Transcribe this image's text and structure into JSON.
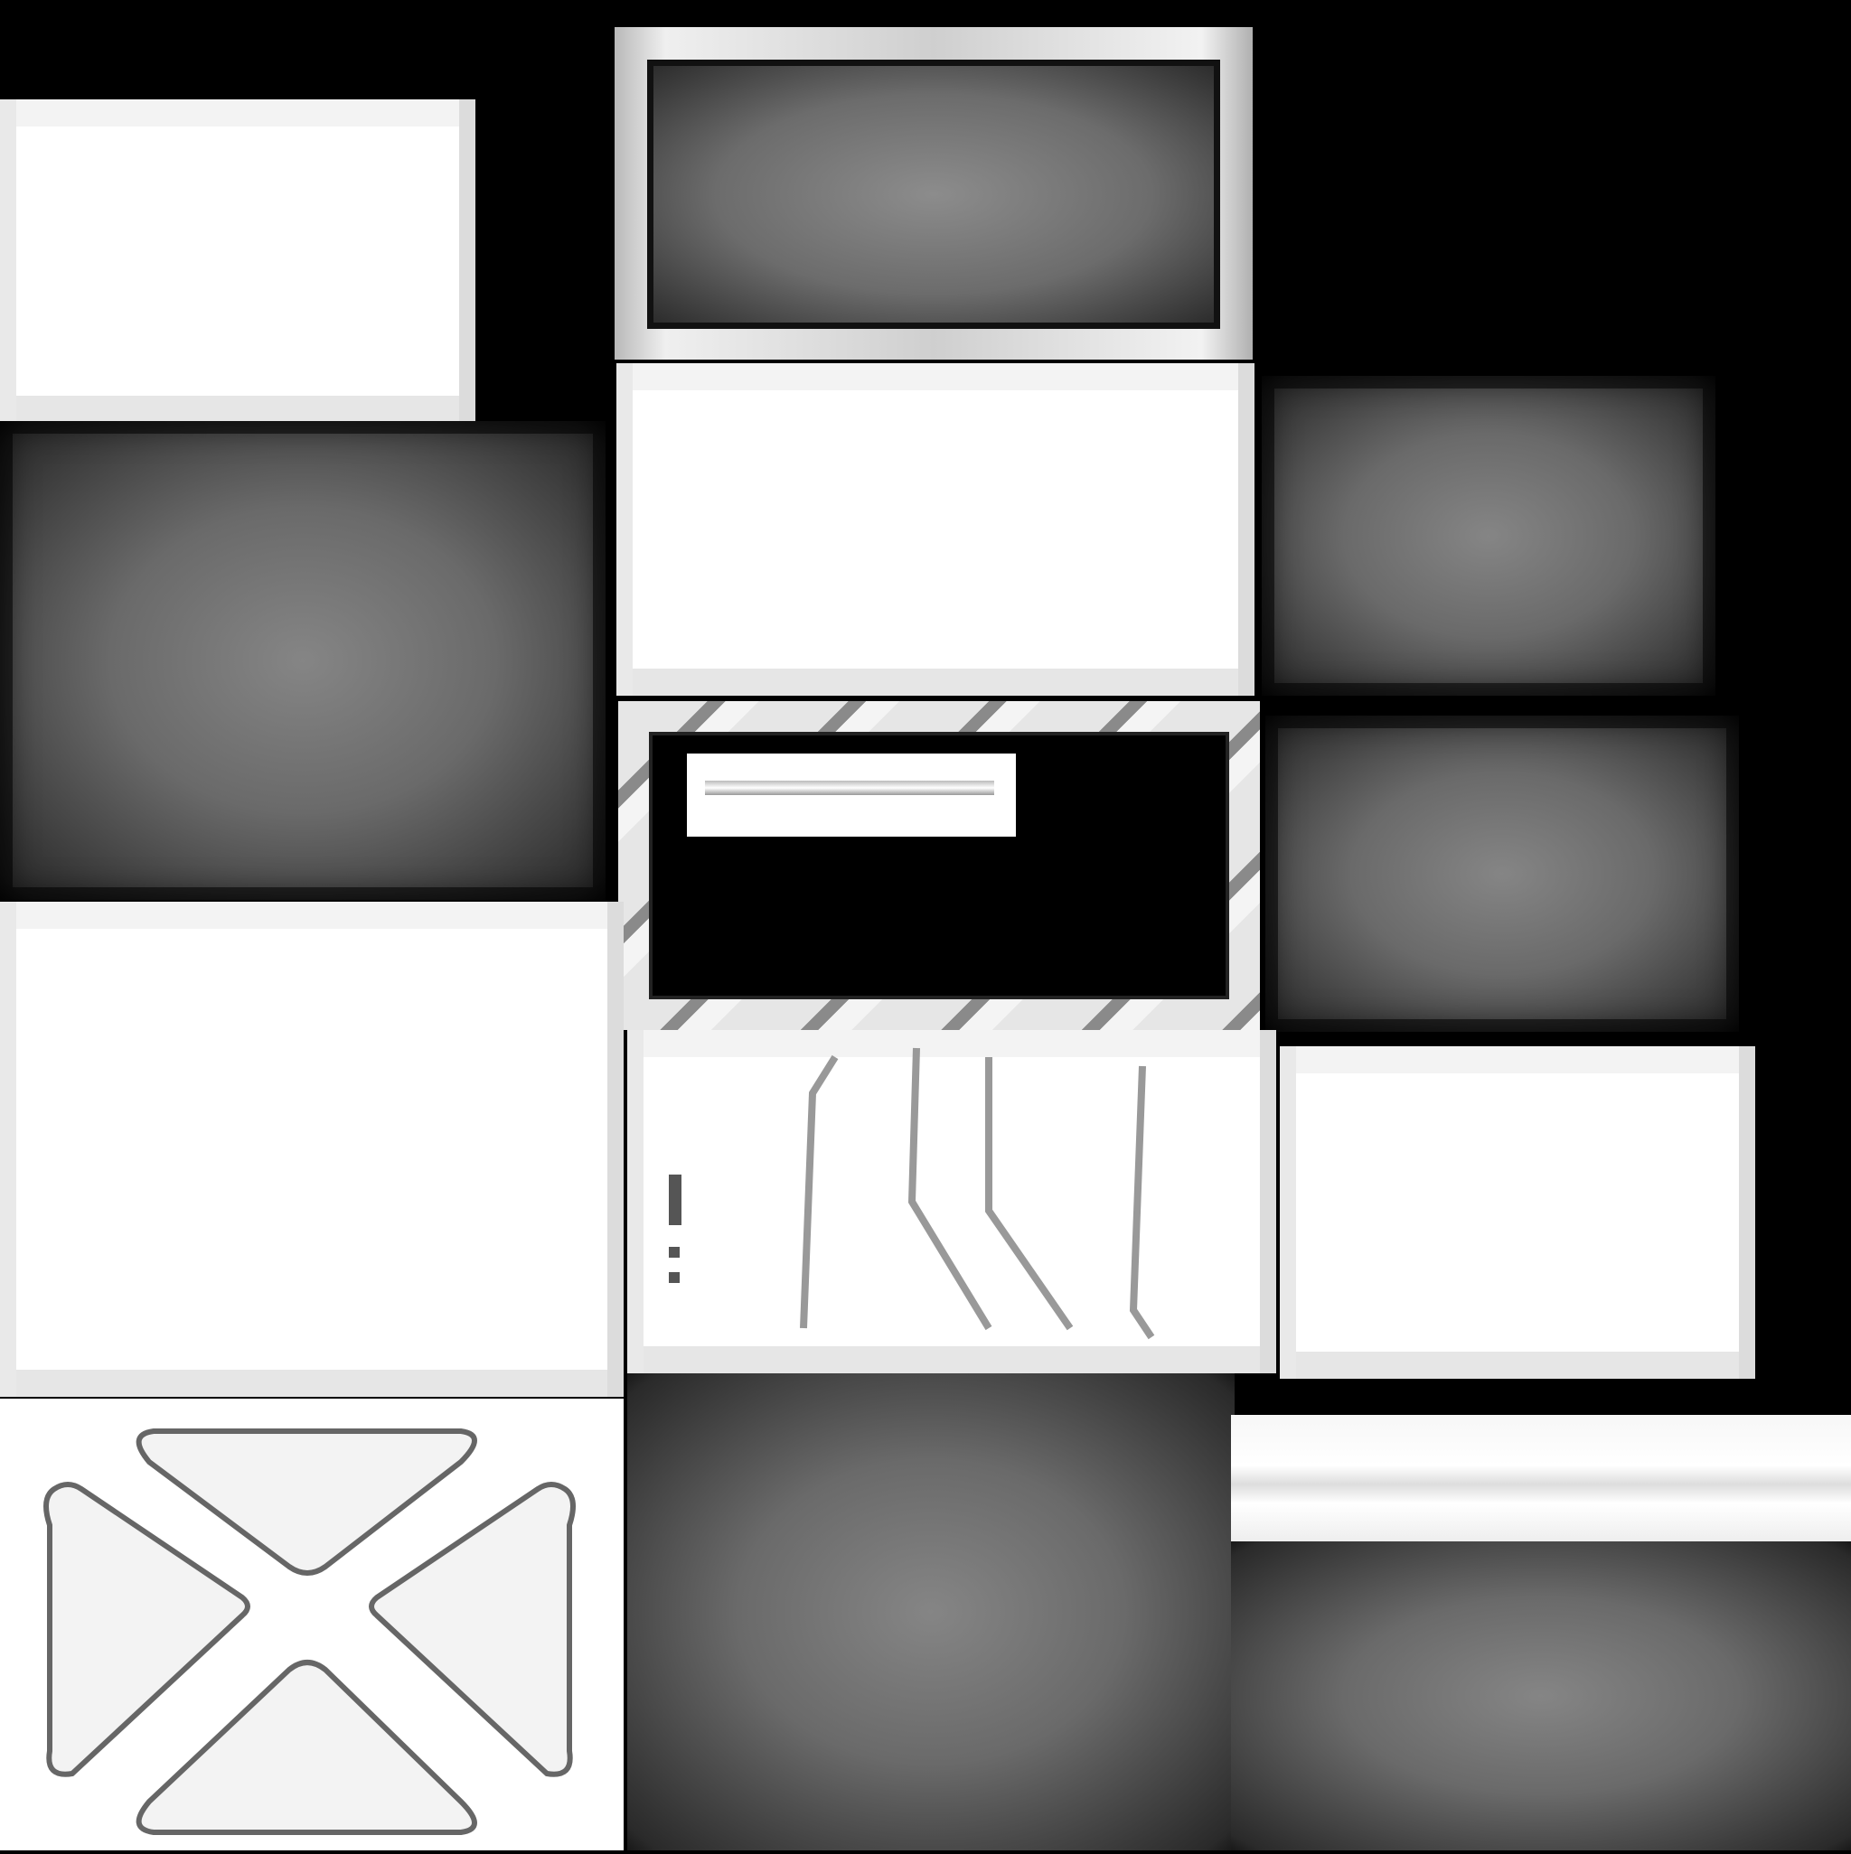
{
  "texture": {
    "kind": "uv-texture-atlas",
    "colors": {
      "background": "#000000",
      "panel_white": "#ffffff",
      "panel_dark_center": "#858585",
      "panel_dark_edge": "#181818",
      "outline": "#555555"
    }
  }
}
